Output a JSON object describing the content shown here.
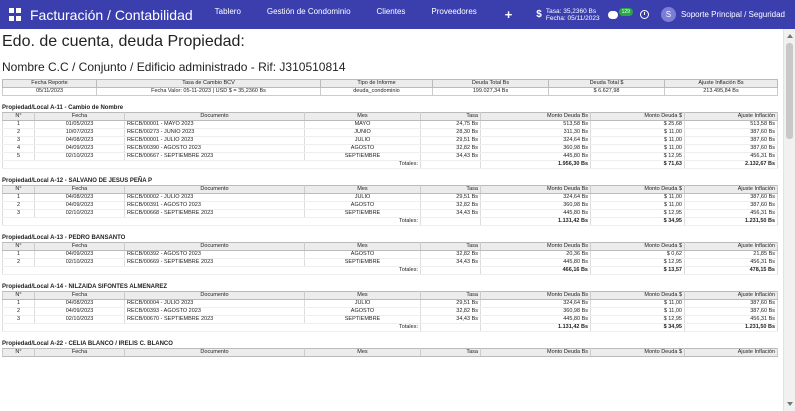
{
  "nav": {
    "brand": "Facturación / Contabilidad",
    "links": [
      "Tablero",
      "Gestión de Condominio",
      "Clientes",
      "Proveedores"
    ],
    "plus": "+",
    "currency_symbol": "$",
    "tasa_line1": "Tasa: 35,2360 Bs",
    "tasa_line2": "Fecha: 05/11/2023",
    "badge": "129",
    "avatar_initial": "S",
    "user": "Soporte Principal / Seguridad"
  },
  "page": {
    "title": "Edo. de cuenta, deuda Propiedad:",
    "subtitle": "Nombre C.C / Conjunto / Edificio administrado - Rif: J310510814"
  },
  "info": {
    "headers": [
      "Fecha Reporte",
      "Tasa de Cambio BCV",
      "Tipo de Informe",
      "Deuda Total Bs",
      "Deuda Total $",
      "Ajuste Inflación Bs"
    ],
    "values": [
      "05/11/2023",
      "Fecha Valor: 05-11-2023 | USD $ = 35,2360 Bs",
      "deuda_condominio",
      "199.027,34 Bs",
      "$ 6.627,98",
      "213.495,84 Bs"
    ]
  },
  "table_headers": [
    "N°",
    "Fecha",
    "Documento",
    "Mes",
    "Tasa",
    "Monto Deuda Bs",
    "Monto Deuda $",
    "Ajuste Inflación"
  ],
  "totals_label": "Totales:",
  "groups": [
    {
      "title": "Propiedad/Local A-11 - Cambio de Nombre",
      "rows": [
        [
          "1",
          "01/05/2023",
          "RECB/00001 - MAYO 2023",
          "MAYO",
          "24,75 Bs",
          "513,58 Bs",
          "$ 25,68",
          "513,58 Bs"
        ],
        [
          "2",
          "10/07/2023",
          "RECB/00273 - JUNIO 2023",
          "JUNIO",
          "28,30 Bs",
          "311,30 Bs",
          "$ 11,00",
          "387,60 Bs"
        ],
        [
          "3",
          "04/08/2023",
          "RECB/00001 - JULIO 2023",
          "JULIO",
          "29,51 Bs",
          "324,64 Bs",
          "$ 11,00",
          "387,60 Bs"
        ],
        [
          "4",
          "04/09/2023",
          "RECB/00390 - AGOSTO 2023",
          "AGOSTO",
          "32,82 Bs",
          "360,98 Bs",
          "$ 11,00",
          "387,60 Bs"
        ],
        [
          "5",
          "02/10/2023",
          "RECB/00667 - SEPTIEMBRE 2023",
          "SEPTIEMBRE",
          "34,43 Bs",
          "445,80 Bs",
          "$ 12,95",
          "456,31 Bs"
        ]
      ],
      "totals": [
        "1.956,30 Bs",
        "$ 71,63",
        "2.132,67 Bs"
      ]
    },
    {
      "title": "Propiedad/Local A-12 - SALVANO DE JESUS PEÑA P",
      "rows": [
        [
          "1",
          "04/08/2023",
          "RECB/00002 - JULIO 2023",
          "JULIO",
          "29,51 Bs",
          "324,64 Bs",
          "$ 11,00",
          "387,60 Bs"
        ],
        [
          "2",
          "04/09/2023",
          "RECB/00391 - AGOSTO 2023",
          "AGOSTO",
          "32,82 Bs",
          "360,98 Bs",
          "$ 11,00",
          "387,60 Bs"
        ],
        [
          "3",
          "02/10/2023",
          "RECB/00668 - SEPTIEMBRE 2023",
          "SEPTIEMBRE",
          "34,43 Bs",
          "445,80 Bs",
          "$ 12,95",
          "456,31 Bs"
        ]
      ],
      "totals": [
        "1.131,42 Bs",
        "$ 34,95",
        "1.231,50 Bs"
      ]
    },
    {
      "title": "Propiedad/Local A-13 - PEDRO BANSANTO",
      "rows": [
        [
          "1",
          "04/09/2023",
          "RECB/00392 - AGOSTO 2023",
          "AGOSTO",
          "32,82 Bs",
          "20,36 Bs",
          "$ 0,62",
          "21,85 Bs"
        ],
        [
          "2",
          "02/10/2023",
          "RECB/00669 - SEPTIEMBRE 2023",
          "SEPTIEMBRE",
          "34,43 Bs",
          "445,80 Bs",
          "$ 12,95",
          "456,31 Bs"
        ]
      ],
      "totals": [
        "466,16 Bs",
        "$ 13,57",
        "478,15 Bs"
      ]
    },
    {
      "title": "Propiedad/Local A-14 - NILZAIDA SIFONTES ALMENAREZ",
      "rows": [
        [
          "1",
          "04/08/2023",
          "RECB/00004 - JULIO 2023",
          "JULIO",
          "29,51 Bs",
          "324,64 Bs",
          "$ 11,00",
          "387,60 Bs"
        ],
        [
          "2",
          "04/09/2023",
          "RECB/00393 - AGOSTO 2023",
          "AGOSTO",
          "32,82 Bs",
          "360,98 Bs",
          "$ 11,00",
          "387,60 Bs"
        ],
        [
          "3",
          "02/10/2023",
          "RECB/00670 - SEPTIEMBRE 2023",
          "SEPTIEMBRE",
          "34,43 Bs",
          "445,80 Bs",
          "$ 12,95",
          "456,31 Bs"
        ]
      ],
      "totals": [
        "1.131,42 Bs",
        "$ 34,95",
        "1.231,50 Bs"
      ]
    },
    {
      "title": "Propiedad/Local A-22 - CELIA BLANCO / IRELIS C. BLANCO",
      "rows": [],
      "totals": null
    }
  ]
}
